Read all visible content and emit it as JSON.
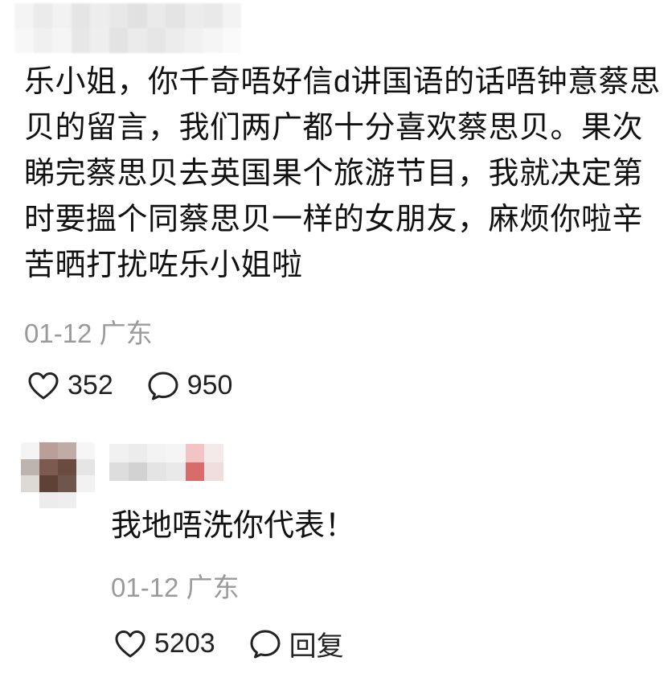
{
  "comment": {
    "text": "乐小姐，你千奇唔好信d讲国语的话唔钟意蔡思贝的留言，我们两广都十分喜欢蔡思贝。果次睇完蔡思贝去英国果个旅游节目，我就决定第时要搵个同蔡思贝一样的女朋友，麻烦你啦辛苦晒打扰咗乐小姐啦",
    "date": "01-12",
    "location": "广东",
    "likes": "352",
    "replies": "950"
  },
  "reply": {
    "text": "我地唔洗你代表！",
    "date": "01-12",
    "location": "广东",
    "likes": "5203",
    "reply_label": "回复"
  },
  "colors": {
    "text": "#111111",
    "meta": "#9a9a9a",
    "icon": "#222222"
  },
  "icons": {
    "like": "heart-outline",
    "comment": "speech-bubble-outline"
  }
}
